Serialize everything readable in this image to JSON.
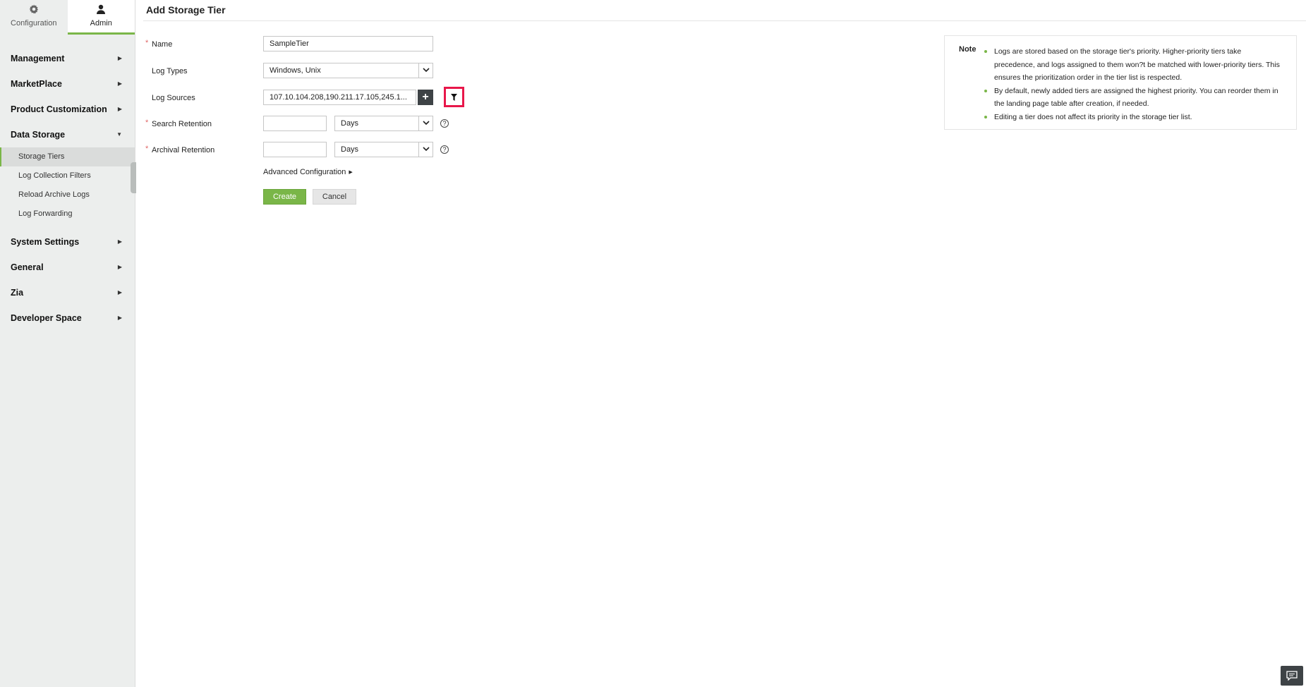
{
  "sidebar": {
    "tabs": [
      {
        "label": "Configuration",
        "icon": "gear-icon",
        "active": false
      },
      {
        "label": "Admin",
        "icon": "user-icon",
        "active": true
      }
    ],
    "groups": [
      {
        "label": "Management"
      },
      {
        "label": "MarketPlace"
      },
      {
        "label": "Product Customization"
      },
      {
        "label": "Data Storage",
        "expanded": true,
        "items": [
          "Storage Tiers",
          "Log Collection Filters",
          "Reload Archive Logs",
          "Log Forwarding"
        ]
      },
      {
        "label": "System Settings"
      },
      {
        "label": "General"
      },
      {
        "label": "Zia"
      },
      {
        "label": "Developer Space"
      }
    ]
  },
  "page": {
    "title": "Add Storage Tier"
  },
  "form": {
    "name": {
      "label": "Name",
      "required": true,
      "value": "SampleTier"
    },
    "log_types": {
      "label": "Log Types",
      "value": "Windows, Unix"
    },
    "log_sources": {
      "label": "Log Sources",
      "value": "107.10.104.208,190.211.17.105,245.1..."
    },
    "search_retention": {
      "label": "Search Retention",
      "required": true,
      "value": "",
      "unit": "Days",
      "help": "?"
    },
    "archival_retention": {
      "label": "Archival Retention",
      "required": true,
      "value": "",
      "unit": "Days",
      "help": "?"
    },
    "required_mark": "*",
    "add_label": "+",
    "advanced_label": "Advanced Configuration",
    "create_label": "Create",
    "cancel_label": "Cancel"
  },
  "note": {
    "title": "Note",
    "items": [
      "Logs are stored based on the storage tier's priority. Higher-priority tiers take precedence, and logs assigned to them won?t be matched with lower-priority tiers. This ensures the prioritization order in the tier list is respected.",
      "By default, newly added tiers are assigned the highest priority. You can reorder them in the landing page table after creation, if needed.",
      "Editing a tier does not affect its priority in the storage tier list."
    ]
  },
  "colors": {
    "accent": "#7ab648",
    "highlight": "#e8174a",
    "dark_button": "#3e4346",
    "required": "#e06666"
  }
}
